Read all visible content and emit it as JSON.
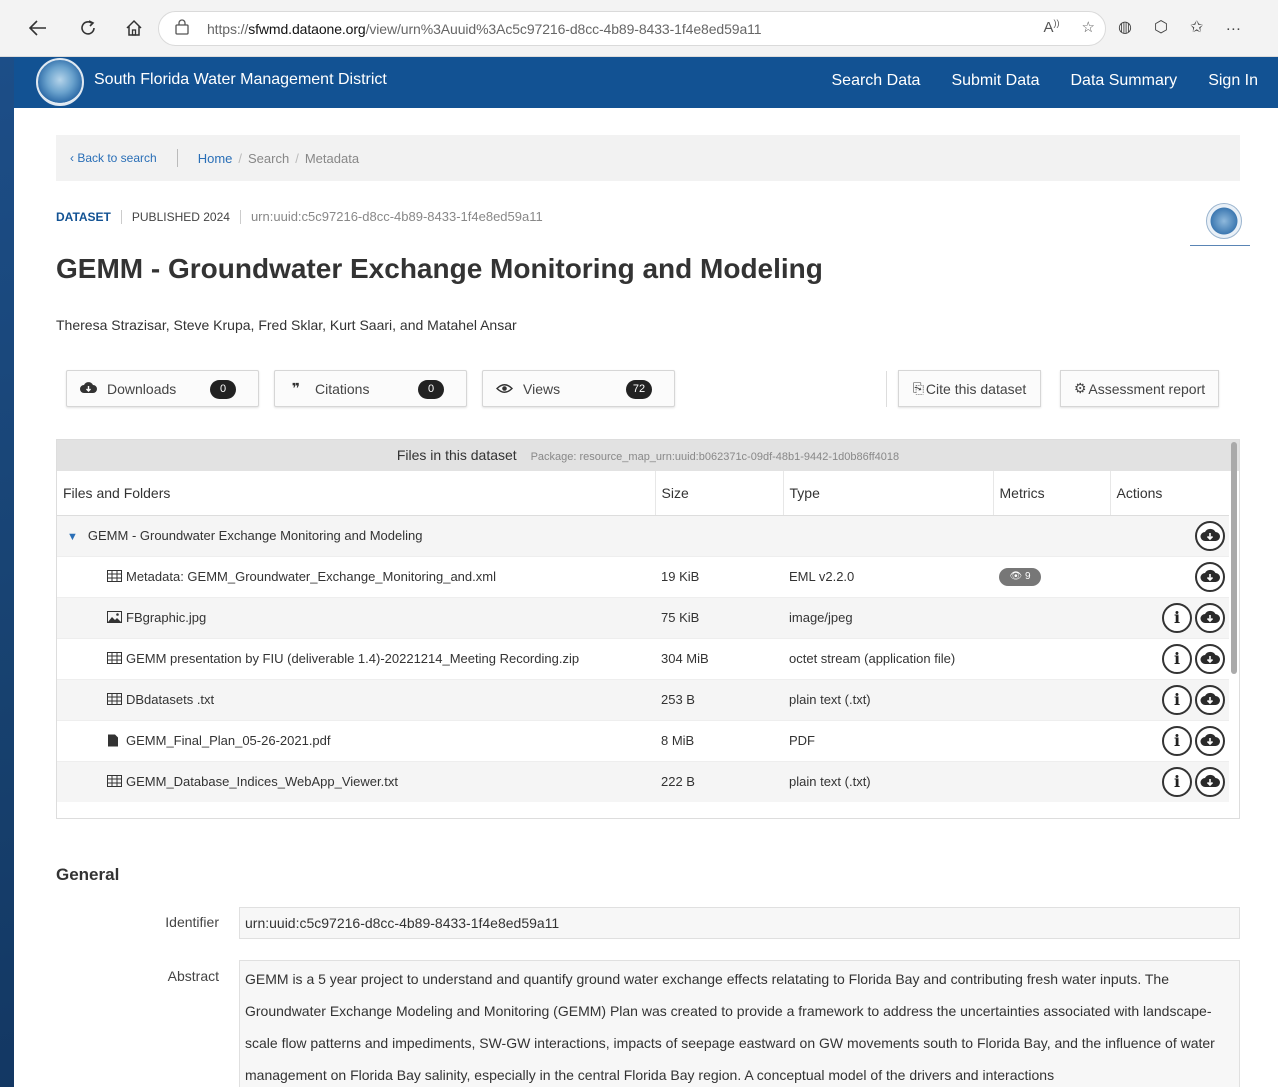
{
  "browser": {
    "url_prefix": "https://",
    "url_host": "sfwmd.dataone.org",
    "url_path": "/view/urn%3Auuid%3Ac5c97216-d8cc-4b89-8433-1f4e8ed59a11",
    "read_aloud_icon": "read-aloud-icon",
    "ellipsis": "…"
  },
  "header": {
    "site_name": "South Florida Water Management District",
    "nav": [
      "Search Data",
      "Submit Data",
      "Data Summary",
      "Sign In"
    ]
  },
  "breadcrumb": {
    "back": "‹ Back to search",
    "home": "Home",
    "search": "Search",
    "metadata": "Metadata"
  },
  "dataset": {
    "tag": "DATASET",
    "published": "PUBLISHED 2024",
    "urn": "urn:uuid:c5c97216-d8cc-4b89-8433-1f4e8ed59a11",
    "title": "GEMM - Groundwater Exchange Monitoring and Modeling",
    "authors": "Theresa Strazisar, Steve Krupa, Fred Sklar, Kurt Saari, and Matahel Ansar"
  },
  "metrics": {
    "downloads_label": "Downloads",
    "downloads_count": "0",
    "citations_label": "Citations",
    "citations_count": "0",
    "views_label": "Views",
    "views_count": "72"
  },
  "actions": {
    "cite": "Cite this dataset",
    "assessment": "Assessment report"
  },
  "files": {
    "heading": "Files in this dataset",
    "package": "Package: resource_map_urn:uuid:b062371c-09df-48b1-9442-1d0b86ff4018",
    "columns": [
      "Files and Folders",
      "Size",
      "Type",
      "Metrics",
      "Actions"
    ],
    "folder": "GEMM - Groundwater Exchange Monitoring and Modeling",
    "rows": [
      {
        "name": "Metadata: GEMM_Groundwater_Exchange_Monitoring_and.xml",
        "size": "19 KiB",
        "type": "EML v2.2.0",
        "metric": "9",
        "icon": "table-icon"
      },
      {
        "name": "FBgraphic.jpg",
        "size": "75 KiB",
        "type": "image/jpeg",
        "metric": "",
        "icon": "image-icon"
      },
      {
        "name": "GEMM presentation by FIU (deliverable 1.4)-20221214_Meeting Recording.zip",
        "size": "304 MiB",
        "type": "octet stream (application file)",
        "metric": "",
        "icon": "table-icon"
      },
      {
        "name": "DBdatasets .txt",
        "size": "253 B",
        "type": "plain text (.txt)",
        "metric": "",
        "icon": "table-icon"
      },
      {
        "name": "GEMM_Final_Plan_05-26-2021.pdf",
        "size": "8 MiB",
        "type": "PDF",
        "metric": "",
        "icon": "file-icon"
      },
      {
        "name": "GEMM_Database_Indices_WebApp_Viewer.txt",
        "size": "222 B",
        "type": "plain text (.txt)",
        "metric": "",
        "icon": "table-icon"
      }
    ]
  },
  "general": {
    "heading": "General",
    "identifier_label": "Identifier",
    "identifier": "urn:uuid:c5c97216-d8cc-4b89-8433-1f4e8ed59a11",
    "abstract_label": "Abstract",
    "abstract": "GEMM is a 5 year project to understand and quantify ground water exchange effects relatating to Florida Bay and contributing fresh water inputs. The Groundwater Exchange Modeling and Monitoring (GEMM) Plan was created to provide a framework to address the uncertainties associated with landscape-scale flow patterns and impediments, SW-GW interactions, impacts of seepage eastward on GW movements south to Florida Bay, and the influence of water management on Florida Bay salinity, especially in the central Florida Bay region. A conceptual model of the drivers and interactions"
  },
  "colors": {
    "header_blue": "#125293",
    "link_blue": "#2a6fb7"
  }
}
